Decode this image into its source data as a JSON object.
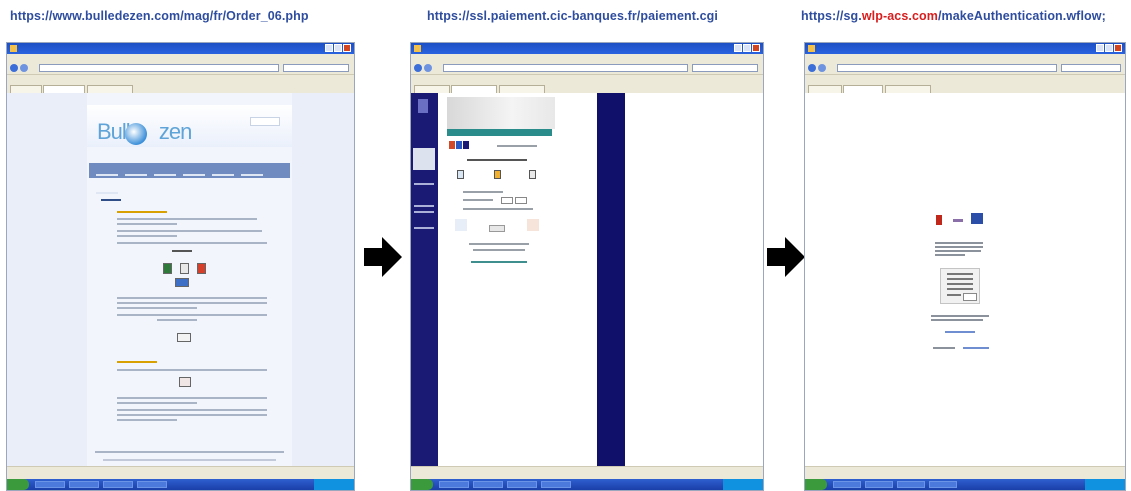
{
  "captions": [
    {
      "prefix": "https://www.bulledezen.com/mag/fr/Order_06.php",
      "highlight": "",
      "suffix": ""
    },
    {
      "prefix": "https://ssl.paiement.cic-banques.fr/paiement.cgi",
      "highlight": "",
      "suffix": ""
    },
    {
      "prefix": "https://sg.",
      "highlight": "wlp-acs.com",
      "suffix": "/makeAuthentication.wflow;"
    }
  ],
  "colors": {
    "caption": "#2e4d9e",
    "caption_highlight": "#d81e1e",
    "arrow": "#000000"
  },
  "arrows": [
    "arrow-right-icon",
    "arrow-right-icon"
  ],
  "screens": [
    {
      "id": "bulledezen",
      "logo_text": "Bulle",
      "logo_text2": "zen"
    },
    {
      "id": "cic"
    },
    {
      "id": "acs"
    }
  ]
}
